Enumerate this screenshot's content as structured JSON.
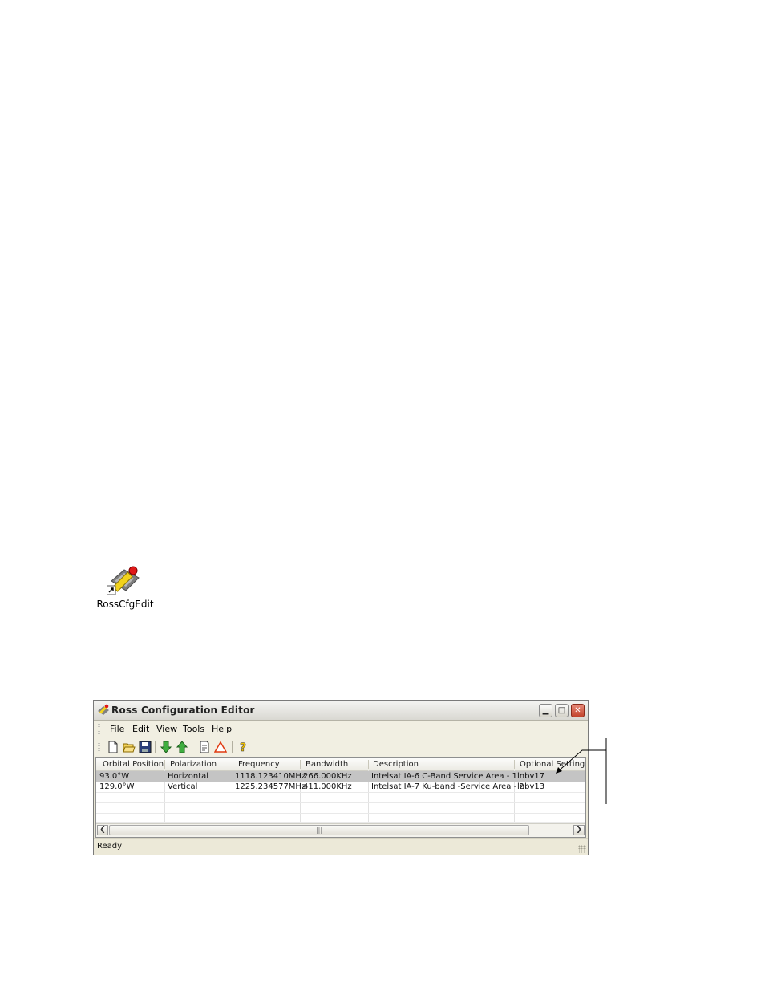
{
  "desktop": {
    "shortcut_label": "RossCfgEdit"
  },
  "window": {
    "title": "Ross Configuration Editor",
    "menu": [
      "File",
      "Edit",
      "View",
      "Tools",
      "Help"
    ],
    "toolbar_icons": [
      "new-icon",
      "open-icon",
      "save-icon",
      "download-icon",
      "upload-icon",
      "properties-icon",
      "warning-icon",
      "help-icon"
    ],
    "columns": [
      "Orbital Position",
      "Polarization",
      "Frequency",
      "Bandwidth",
      "Description",
      "Optional Settings"
    ],
    "rows": [
      [
        "93.0°W",
        "Horizontal",
        "1118.123410MHz",
        "266.000KHz",
        "Intelsat IA-6 C-Band Service Area - 1",
        "lnbv17"
      ],
      [
        "129.0°W",
        "Vertical",
        "1225.234577MHz",
        "411.000KHz",
        "Intelsat IA-7 Ku-band -Service Area - 2",
        "lnbv13"
      ]
    ],
    "selected_row": 0,
    "status": "Ready"
  },
  "colors": {
    "selection": "#c4c4c4",
    "close_button": "#c2432c",
    "window_bg": "#ece9d8"
  }
}
